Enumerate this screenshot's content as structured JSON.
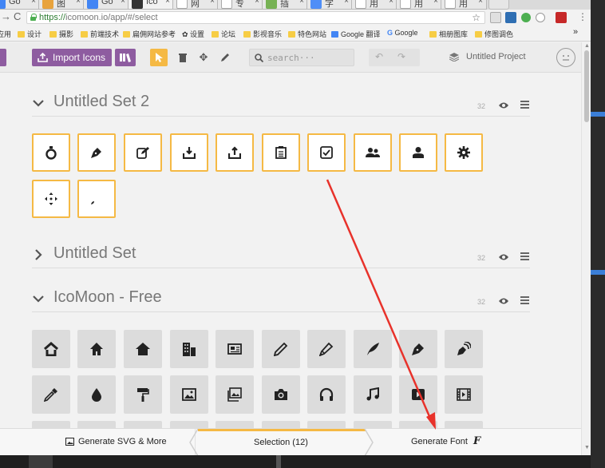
{
  "browser": {
    "tabs": [
      {
        "label": "Go",
        "icon_color": "#4285f4"
      },
      {
        "label": "图",
        "icon_color": "#e8a33d"
      },
      {
        "label": "Go",
        "icon_color": "#4285f4"
      },
      {
        "label": "Ico",
        "icon_color": "#333333"
      },
      {
        "label": "网",
        "icon_color": "#cccccc"
      },
      {
        "label": "专",
        "icon_color": "#cccccc"
      },
      {
        "label": "插",
        "icon_color": "#77b255"
      },
      {
        "label": "字",
        "icon_color": "#4f8ef7"
      },
      {
        "label": "用",
        "icon_color": "#cccccc"
      },
      {
        "label": "用",
        "icon_color": "#cccccc"
      },
      {
        "label": "用",
        "icon_color": "#cccccc"
      }
    ],
    "url_scheme": "https://",
    "url_rest": "icomoon.io/app/#/select",
    "bookmarks": [
      {
        "label": "应用",
        "type": "apps"
      },
      {
        "label": "设计",
        "type": "folder"
      },
      {
        "label": "摄影",
        "type": "folder"
      },
      {
        "label": "前端技术",
        "type": "folder"
      },
      {
        "label": "扁佣网站参考",
        "type": "folder"
      },
      {
        "label": "设置",
        "type": "gear"
      },
      {
        "label": "论坛",
        "type": "folder"
      },
      {
        "label": "影视音乐",
        "type": "folder"
      },
      {
        "label": "特色网站",
        "type": "folder"
      },
      {
        "label": "Google 翻译",
        "type": "translate"
      },
      {
        "label": "Google",
        "type": "google"
      },
      {
        "label": "相册图库",
        "type": "folder"
      },
      {
        "label": "修图调色",
        "type": "folder"
      }
    ],
    "bookmarks_overflow": "»"
  },
  "toolbar": {
    "import_label": "Import Icons",
    "search_placeholder": "search···",
    "project_label": "Untitled Project"
  },
  "sets": [
    {
      "title": "Untitled Set 2",
      "count": "32",
      "expanded": true
    },
    {
      "title": "Untitled Set",
      "count": "32",
      "expanded": false
    },
    {
      "title": "IcoMoon - Free",
      "count": "32",
      "expanded": true
    }
  ],
  "selected_glyphs": [
    "stopwatch-icon",
    "pen-icon",
    "edit-icon",
    "download-icon",
    "upload-icon",
    "clipboard-icon",
    "checkbox-icon",
    "users-icon",
    "user-icon",
    "cog-icon",
    "move-icon",
    "brush-icon"
  ],
  "free_glyphs": [
    "home-icon",
    "home2-icon",
    "home3-icon",
    "office-icon",
    "newspaper-icon",
    "pencil-icon",
    "pencil2-icon",
    "quill-icon",
    "pen-icon",
    "blog-icon",
    "eyedropper-icon",
    "droplet-icon",
    "paint-format-icon",
    "image-icon",
    "images-icon",
    "camera-icon",
    "headphones-icon",
    "music-icon",
    "play-icon",
    "film-icon"
  ],
  "bottom": {
    "generate_svg": "Generate SVG & More",
    "selection": "Selection (12)",
    "generate_font": "Generate Font"
  },
  "colors": {
    "accent_orange": "#f5b944",
    "purple": "#8e5ca0",
    "arrow": "#e8322b"
  }
}
